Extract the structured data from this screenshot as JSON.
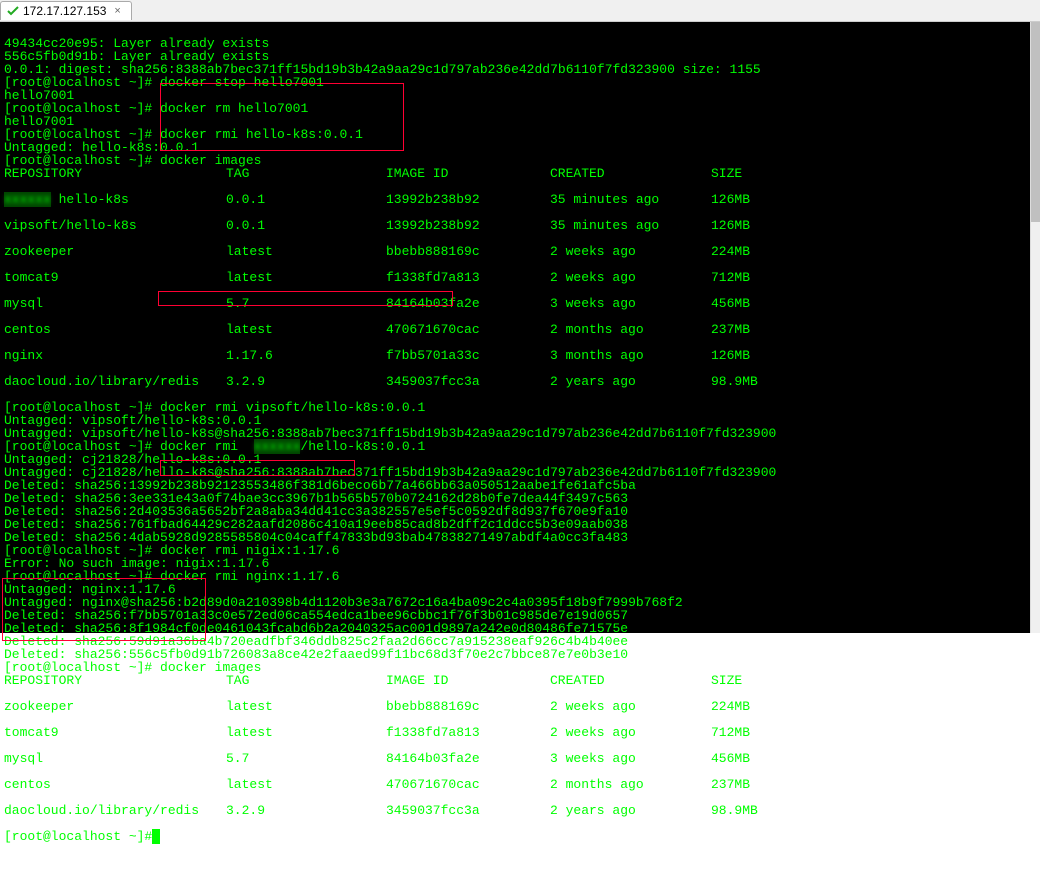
{
  "tab": {
    "ip": "172.17.127.153",
    "close": "×"
  },
  "line1": "49434cc20e95: Layer already exists",
  "line2": "556c5fb0d91b: Layer already exists",
  "line3": "0.0.1: digest: sha256:8388ab7bec371ff15bd19b3b42a9aa29c1d797ab236e42dd7b6110f7fd323900 size: 1155",
  "prompt": "[root@localhost ~]#",
  "cmd_stop": " docker stop hello7001",
  "resp_stop": "hello7001",
  "cmd_rm": " docker rm hello7001",
  "resp_rm": "hello7001",
  "cmd_rmi1": " docker rmi hello-k8s:0.0.1",
  "untag1": "Untagged: hello-k8s:0.0.1",
  "cmd_images": " docker images",
  "tbl_hdr": {
    "repo": "REPOSITORY",
    "tag": "TAG",
    "id": "IMAGE ID",
    "cr": "CREATED",
    "sz": "SIZE"
  },
  "tbl1": [
    {
      "repo_prefix": "",
      "blur": "xxxxxx",
      "repo_mid": " hello-k8s",
      "tag": "0.0.1",
      "id": "13992b238b92",
      "cr": "35 minutes ago",
      "sz": "126MB"
    },
    {
      "repo": "vipsoft/hello-k8s",
      "tag": "0.0.1",
      "id": "13992b238b92",
      "cr": "35 minutes ago",
      "sz": "126MB"
    },
    {
      "repo": "zookeeper",
      "tag": "latest",
      "id": "bbebb888169c",
      "cr": "2 weeks ago",
      "sz": "224MB"
    },
    {
      "repo": "tomcat9",
      "tag": "latest",
      "id": "f1338fd7a813",
      "cr": "2 weeks ago",
      "sz": "712MB"
    },
    {
      "repo": "mysql",
      "tag": "5.7",
      "id": "84164b03fa2e",
      "cr": "3 weeks ago",
      "sz": "456MB"
    },
    {
      "repo": "centos",
      "tag": "latest",
      "id": "470671670cac",
      "cr": "2 months ago",
      "sz": "237MB"
    },
    {
      "repo": "nginx",
      "tag": "1.17.6",
      "id": "f7bb5701a33c",
      "cr": "3 months ago",
      "sz": "126MB"
    },
    {
      "repo": "daocloud.io/library/redis",
      "tag": "3.2.9",
      "id": "3459037fcc3a",
      "cr": "2 years ago",
      "sz": "98.9MB"
    }
  ],
  "cmd_rmi_vip": " docker rmi vipsoft/hello-k8s:0.0.1",
  "untag_vip1": "Untagged: vipsoft/hello-k8s:0.0.1",
  "untag_vip2": "Untagged: vipsoft/hello-k8s@sha256:8388ab7bec371ff15bd19b3b42a9aa29c1d797ab236e42dd7b6110f7fd323900",
  "cmd_rmi_cj_pre": " docker rmi  ",
  "cmd_rmi_cj_post": "/hello-k8s:0.0.1",
  "untag_cj1": "Untagged: cj21828/hello-k8s:0.0.1",
  "untag_cj2": "Untagged: cj21828/hello-k8s@sha256:8388ab7bec371ff15bd19b3b42a9aa29c1d797ab236e42dd7b6110f7fd323900",
  "del1": "Deleted: sha256:13992b238b92123553486f381d6beco6b77a466bb63a050512aabe1fe61afc5ba",
  "del2": "Deleted: sha256:3ee331e43a0f74bae3cc3967b1b565b570b0724162d28b0fe7dea44f3497c563",
  "del3": "Deleted: sha256:2d403536a5652bf2a8aba34dd41cc3a382557e5ef5c0592df8d937f670e9fa10",
  "del4": "Deleted: sha256:761fbad64429c282aafd2086c410a19eeb85cad8b2dff2c1ddcc5b3e09aab038",
  "del5": "Deleted: sha256:4dab5928d9285585804c04caff47833bd93bab47838271497abdf4a0cc3fa483",
  "cmd_rmi_nigix": " docker rmi nigix:1.17.6",
  "err_nigix": "Error: No such image: nigix:1.17.6",
  "cmd_rmi_nginx": " docker rmi nginx:1.17.6",
  "untag_ng1": "Untagged: nginx:1.17.6",
  "untag_ng2": "Untagged: nginx@sha256:b2d89d0a210398b4d1120b3e3a7672c16a4ba09c2c4a0395f18b9f7999b768f2",
  "del_ng1": "Deleted: sha256:f7bb5701a33c0e572ed06ca554edca1bee96cbbc1f76f3b01c985de7e19d0657",
  "del_ng2": "Deleted: sha256:8f1984cf0de0461043fcabd6b2a2040325ac001d9897a242e0d80486fe71575e",
  "del_ng3": "Deleted: sha256:59d91a36ba4b720eadfbf346ddb825c2faa2d66cc7a915238eaf926c4b4b40ee",
  "del_ng4": "Deleted: sha256:556c5fb0d91b726083a8ce42e2faaed99f11bc68d3f70e2c7bbce87e7e0b3e10",
  "tbl2": [
    {
      "repo": "zookeeper",
      "tag": "latest",
      "id": "bbebb888169c",
      "cr": "2 weeks ago",
      "sz": "224MB"
    },
    {
      "repo": "tomcat9",
      "tag": "latest",
      "id": "f1338fd7a813",
      "cr": "2 weeks ago",
      "sz": "712MB"
    },
    {
      "repo": "mysql",
      "tag": "5.7",
      "id": "84164b03fa2e",
      "cr": "3 weeks ago",
      "sz": "456MB"
    },
    {
      "repo": "centos",
      "tag": "latest",
      "id": "470671670cac",
      "cr": "2 months ago",
      "sz": "237MB"
    },
    {
      "repo": "daocloud.io/library/redis",
      "tag": "3.2.9",
      "id": "3459037fcc3a",
      "cr": "2 years ago",
      "sz": "98.9MB"
    }
  ],
  "cursor": " "
}
